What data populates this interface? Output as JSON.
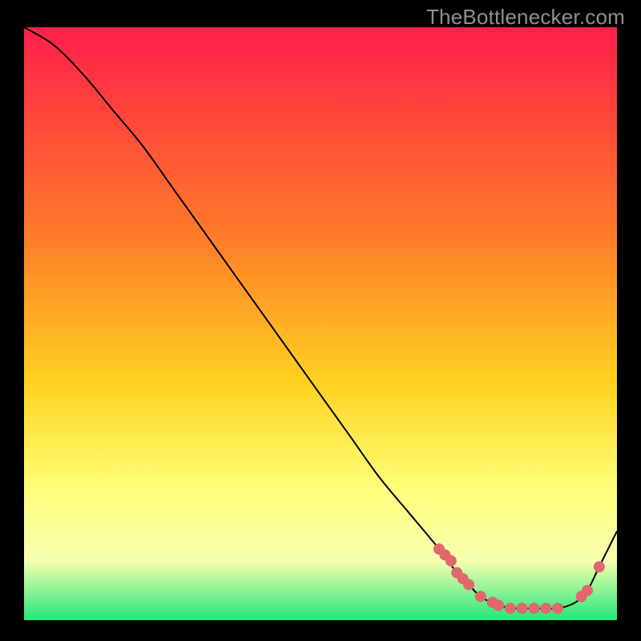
{
  "attribution": "TheBottlenecker.com",
  "gradient_colors": {
    "top": "#ff1f4a",
    "mid1": "#ff7a2a",
    "mid2": "#ffd21f",
    "mid3": "#ffff7a",
    "mid4": "#f6ffb0",
    "bottom": "#22e67a"
  },
  "curve_stroke": "#000000",
  "marker_color": "#e0686c",
  "chart_data": {
    "type": "line",
    "title": "",
    "xlabel": "",
    "ylabel": "",
    "xlim": [
      0,
      100
    ],
    "ylim": [
      0,
      100
    ],
    "grid": false,
    "legend": false,
    "series": [
      {
        "name": "bottleneck-curve",
        "x": [
          0,
          5,
          10,
          15,
          20,
          25,
          30,
          35,
          40,
          45,
          50,
          55,
          60,
          65,
          70,
          73,
          75,
          77,
          80,
          83,
          86,
          90,
          93,
          95,
          97,
          100
        ],
        "y": [
          100,
          97,
          92,
          86,
          80,
          73,
          66,
          59,
          52,
          45,
          38,
          31,
          24,
          18,
          12,
          8,
          6,
          4,
          2.5,
          2,
          2,
          2,
          3,
          5,
          9,
          15
        ]
      }
    ],
    "markers": [
      {
        "x": 70,
        "y": 12
      },
      {
        "x": 71,
        "y": 11
      },
      {
        "x": 72,
        "y": 10
      },
      {
        "x": 73,
        "y": 8
      },
      {
        "x": 74,
        "y": 7
      },
      {
        "x": 75,
        "y": 6
      },
      {
        "x": 77,
        "y": 4
      },
      {
        "x": 79,
        "y": 3
      },
      {
        "x": 80,
        "y": 2.5
      },
      {
        "x": 82,
        "y": 2
      },
      {
        "x": 84,
        "y": 2
      },
      {
        "x": 86,
        "y": 2
      },
      {
        "x": 88,
        "y": 2
      },
      {
        "x": 90,
        "y": 2
      },
      {
        "x": 94,
        "y": 4
      },
      {
        "x": 95,
        "y": 5
      },
      {
        "x": 97,
        "y": 9
      }
    ]
  }
}
